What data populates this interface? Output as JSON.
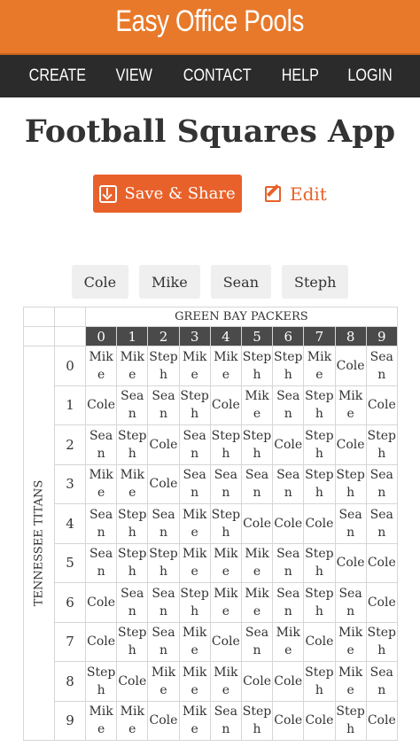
{
  "brand": {
    "title": "Easy Office Pools"
  },
  "nav": {
    "items": [
      "CREATE",
      "VIEW",
      "CONTACT",
      "HELP",
      "LOGIN"
    ]
  },
  "page": {
    "title": "Football Squares App"
  },
  "actions": {
    "save_label": "Save & Share",
    "edit_label": "Edit"
  },
  "players": [
    "Cole",
    "Mike",
    "Sean",
    "Steph"
  ],
  "grid": {
    "top_team": "GREEN BAY PACKERS",
    "side_team": "TENNESSEE TITANS",
    "columns": [
      "0",
      "1",
      "2",
      "3",
      "4",
      "5",
      "6",
      "7",
      "8",
      "9"
    ],
    "rows": [
      {
        "label": "0",
        "cells": [
          "Mike",
          "Mike",
          "Steph",
          "Mike",
          "Mike",
          "Steph",
          "Steph",
          "Mike",
          "Cole",
          "Sean"
        ]
      },
      {
        "label": "1",
        "cells": [
          "Cole",
          "Sean",
          "Sean",
          "Steph",
          "Cole",
          "Mike",
          "Sean",
          "Steph",
          "Mike",
          "Cole"
        ]
      },
      {
        "label": "2",
        "cells": [
          "Sean",
          "Steph",
          "Cole",
          "Sean",
          "Steph",
          "Steph",
          "Cole",
          "Steph",
          "Cole",
          "Steph"
        ]
      },
      {
        "label": "3",
        "cells": [
          "Mike",
          "Mike",
          "Cole",
          "Sean",
          "Sean",
          "Sean",
          "Sean",
          "Steph",
          "Steph",
          "Sean"
        ]
      },
      {
        "label": "4",
        "cells": [
          "Sean",
          "Steph",
          "Sean",
          "Mike",
          "Steph",
          "Cole",
          "Cole",
          "Cole",
          "Sean",
          "Sean"
        ]
      },
      {
        "label": "5",
        "cells": [
          "Sean",
          "Steph",
          "Steph",
          "Mike",
          "Mike",
          "Mike",
          "Sean",
          "Steph",
          "Cole",
          "Cole"
        ]
      },
      {
        "label": "6",
        "cells": [
          "Cole",
          "Sean",
          "Sean",
          "Steph",
          "Mike",
          "Mike",
          "Sean",
          "Steph",
          "Sean",
          "Cole"
        ]
      },
      {
        "label": "7",
        "cells": [
          "Cole",
          "Steph",
          "Sean",
          "Mike",
          "Cole",
          "Sean",
          "Mike",
          "Cole",
          "Mike",
          "Steph"
        ]
      },
      {
        "label": "8",
        "cells": [
          "Steph",
          "Cole",
          "Mike",
          "Mike",
          "Mike",
          "Cole",
          "Cole",
          "Steph",
          "Mike",
          "Sean"
        ]
      },
      {
        "label": "9",
        "cells": [
          "Mike",
          "Mike",
          "Cole",
          "Mike",
          "Sean",
          "Steph",
          "Cole",
          "Cole",
          "Steph",
          "Cole"
        ]
      }
    ]
  },
  "colors": {
    "brand": "#e8792a",
    "nav_bg": "#2b2b2b",
    "accent": "#e8612a",
    "score_head_bg": "#4a4a4a"
  }
}
